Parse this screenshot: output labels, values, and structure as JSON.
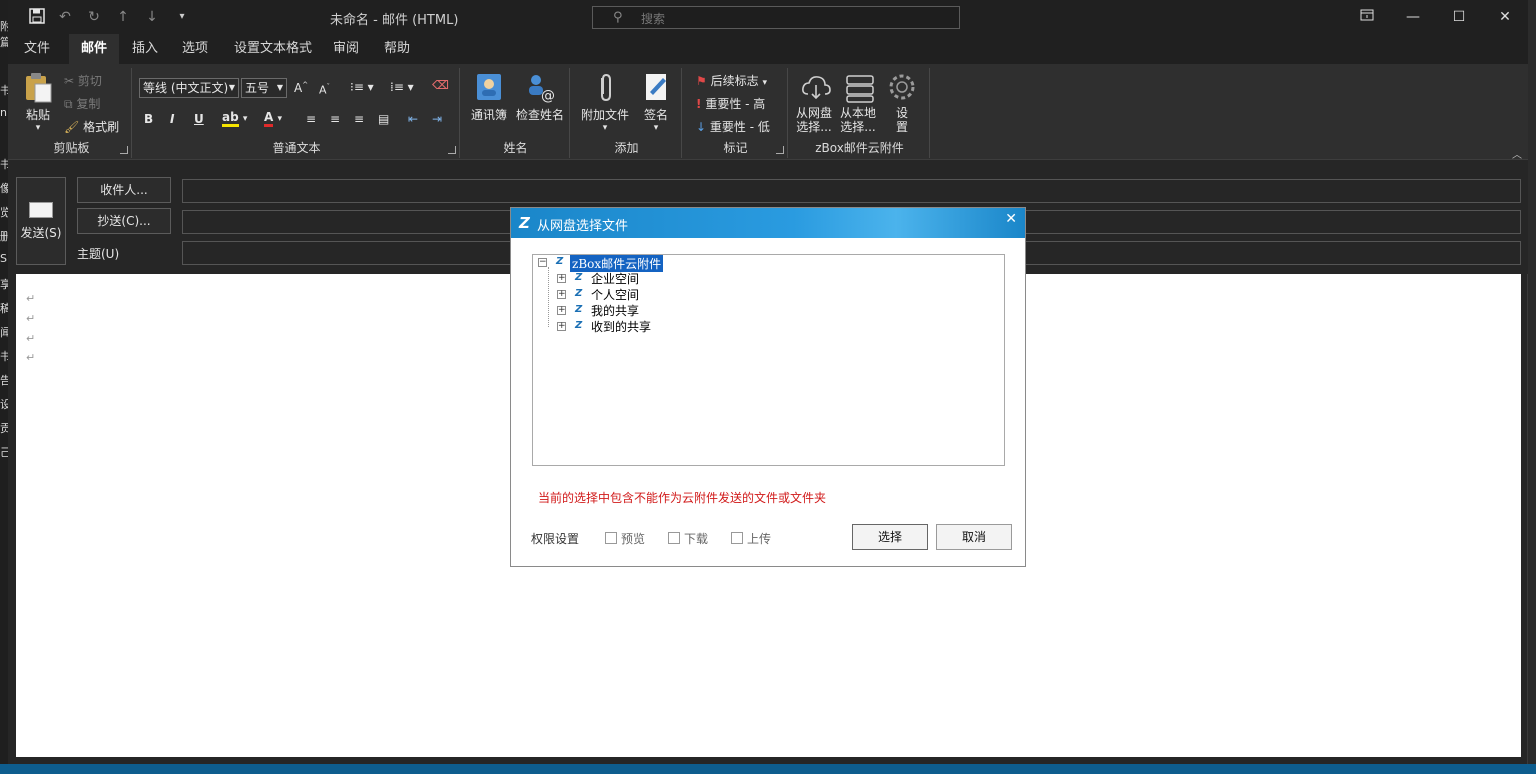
{
  "window": {
    "title": "未命名  -  邮件 (HTML)",
    "search_placeholder": "搜索"
  },
  "left_strip": [
    "’",
    "附",
    "篇",
    "书",
    "n",
    "书",
    "像",
    "览",
    "删",
    "S",
    "享",
    "稿",
    "闻",
    "书",
    "告",
    "设",
    "贡",
    "己"
  ],
  "tabs": [
    "文件",
    "邮件",
    "插入",
    "选项",
    "设置文本格式",
    "审阅",
    "帮助"
  ],
  "active_tab": "邮件",
  "ribbon": {
    "clipboard": {
      "paste": "粘贴",
      "cut": "剪切",
      "copy": "复制",
      "format_painter": "格式刷",
      "label": "剪贴板"
    },
    "basic_text": {
      "font": "等线 (中文正文)",
      "size": "五号",
      "label": "普通文本"
    },
    "names": {
      "address_book": "通讯簿",
      "check_names": "检查姓名",
      "label": "姓名"
    },
    "include": {
      "attach_file": "附加文件",
      "signature": "签名",
      "label": "添加"
    },
    "tags": {
      "follow_up": "后续标志",
      "high_importance": "重要性 - 高",
      "low_importance": "重要性 - 低",
      "label": "标记"
    },
    "zbox": {
      "from_cloud": "从网盘选择...",
      "from_local": "从本地选择...",
      "settings": "设置",
      "label": "zBox邮件云附件"
    }
  },
  "compose": {
    "send": "发送(S)",
    "to": "收件人...",
    "cc": "抄送(C)...",
    "subject": "主题(U)"
  },
  "editor": {
    "paragraph_mark": "↵"
  },
  "dialog": {
    "title": "从网盘选择文件",
    "tree": {
      "root": "zBox邮件云附件",
      "children": [
        "企业空间",
        "个人空间",
        "我的共享",
        "收到的共享"
      ]
    },
    "warning": "当前的选择中包含不能作为云附件发送的文件或文件夹",
    "permissions_label": "权限设置",
    "permissions": [
      "预览",
      "下载",
      "上传"
    ],
    "select_button": "选择",
    "cancel_button": "取消"
  }
}
